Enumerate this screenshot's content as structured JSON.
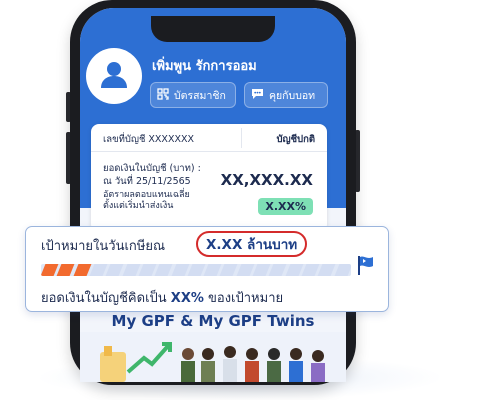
{
  "profile": {
    "name": "เพิ่มพูน รักการออม"
  },
  "actions": {
    "member_card": "บัตรสมาชิก",
    "chat": "คุยกับบอท"
  },
  "account": {
    "number_label": "เลขที่บัญชี XXXXXXX",
    "type": "บัญชีปกติ",
    "balance_label_line1": "ยอดเงินในบัญชี (บาท) :",
    "balance_label_line2": "ณ วันที่ 25/11/2565",
    "balance_value": "XX,XXX.XX",
    "return_label_line1": "อัตราผลตอบแทนเฉลี่ย",
    "return_label_line2": "ตั้งแต่เริ่มนำส่งเงิน",
    "return_value": "X.XX%"
  },
  "goal": {
    "label": "เป้าหมายในวันเกษียณ",
    "amount": "X.XX ล้านบาท",
    "progress_fraction": 0.18,
    "summary_prefix": "ยอดเงินในบัญชีคิดเป็น",
    "summary_percent": "XX%",
    "summary_suffix": "ของเป้าหมาย"
  },
  "promo": {
    "title": "My GPF & My GPF Twins"
  },
  "colors": {
    "brand_blue": "#2d6fd3",
    "navy_text": "#1d3f86",
    "progress_orange": "#f26a2e",
    "badge_green": "#7ee0b5",
    "highlight_red": "#d42b2b"
  },
  "icons": [
    "user-icon",
    "qr-code-icon",
    "chat-bubble-icon",
    "flag-icon"
  ]
}
